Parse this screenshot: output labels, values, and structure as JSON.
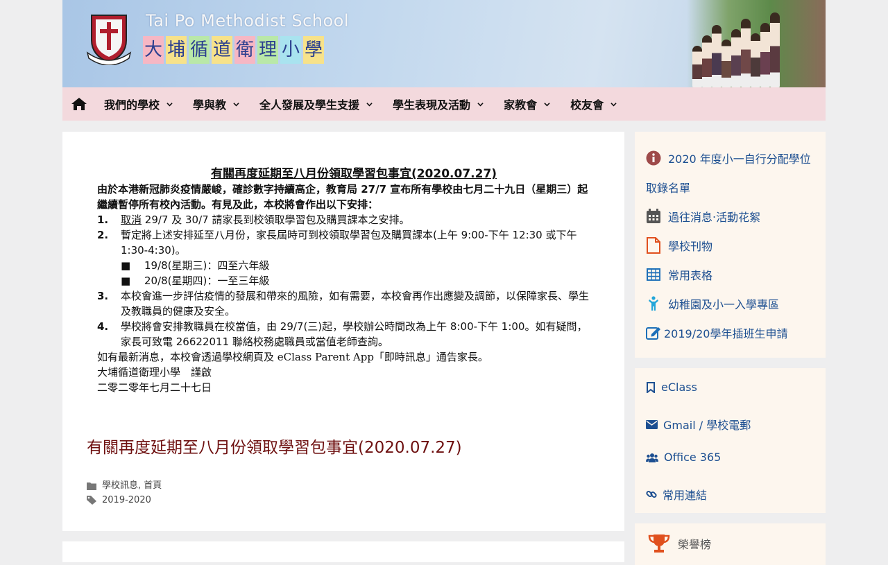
{
  "header": {
    "school_en": "Tai Po Methodist School",
    "school_cn": [
      "大",
      "埔",
      "循",
      "道",
      "衛",
      "理",
      "小",
      "學"
    ],
    "school_cn_bg": [
      "#f6b7c4",
      "#f7e28a",
      "#b9e8a8",
      "#f7e28a",
      "#f6b7c4",
      "#b9e8a8",
      "#a9e3ef",
      "#f7e28a"
    ]
  },
  "nav": {
    "items": [
      {
        "label": "我們的學校"
      },
      {
        "label": "學與教"
      },
      {
        "label": "全人發展及學生支援"
      },
      {
        "label": "學生表現及活動"
      },
      {
        "label": "家教會"
      },
      {
        "label": "校友會"
      }
    ]
  },
  "notice": {
    "title": "有關再度延期至八月份領取學習包事宜(2020.07.27)",
    "intro": "由於本港新冠肺炎疫情嚴峻，確診數字持續高企，教育局 27/7 宣布所有學校由七月二十九日（星期三）起繼續暫停所有校內活動。有見及此，本校將會作出以下安排：",
    "item1_num": "1.",
    "item1_cancel": "取消",
    "item1_rest": " 29/7 及 30/7 請家長到校領取學習包及購買課本之安排。",
    "item2_num": "2.",
    "item2": "暫定將上述安排延至八月份，家長屆時可到校領取學習包及購買課本(上午 9:00-下午 12:30 或下午 1:30-4:30)。",
    "sub1_bullet": "■",
    "sub1": "19/8(星期三)：四至六年級",
    "sub2_bullet": "■",
    "sub2": "20/8(星期四)：一至三年級",
    "item3_num": "3.",
    "item3": "本校會進一步評估疫情的發展和帶來的風險，如有需要，本校會再作出應變及調節，以保障家長、學生及教職員的健康及安全。",
    "item4_num": "4.",
    "item4": "學校將會安排教職員在校當值，由 29/7(三)起，學校辦公時間改為上午 8:00-下午 1:00。如有疑問，家長可致電 26622011 聯絡校務處職員或當值老師查詢。",
    "footer1": "如有最新消息，本校會透過學校網頁及 eClass Parent App「即時訊息」通告家長。",
    "footer2": "大埔循道衛理小學　謹啟",
    "footer3": "二零二零年七月二十七日"
  },
  "post": {
    "title": "有關再度延期至八月份領取學習包事宜(2020.07.27)",
    "categories": "學校訊息, 首頁",
    "tags": "2019-2020"
  },
  "sidebar": {
    "links": [
      {
        "label": "2020 年度小一自行分配學位",
        "label2": "取錄名單",
        "icon": "info-icon"
      },
      {
        "label": "過往消息‧活動花絮",
        "icon": "calendar-icon"
      },
      {
        "label": "學校刊物",
        "icon": "document-icon"
      },
      {
        "label": "常用表格",
        "icon": "table-icon"
      },
      {
        "label": "幼稚園及小一入學專區",
        "icon": "child-icon"
      },
      {
        "label": "2019/20學年插班生申請",
        "icon": "edit-icon"
      }
    ],
    "links2": [
      {
        "label": "eClass",
        "icon": "bookmark-icon"
      },
      {
        "label": "Gmail / 學校電郵",
        "icon": "envelope-icon"
      },
      {
        "label": "Office 365",
        "icon": "users-icon"
      },
      {
        "label": "常用連結",
        "icon": "link-icon"
      }
    ],
    "honor": "榮譽榜"
  },
  "colors": {
    "nav_bg": "#f3d9dd",
    "link": "#1d4f91",
    "post_title": "#6e1010",
    "sidebar_bg": "#fdf6ee"
  }
}
